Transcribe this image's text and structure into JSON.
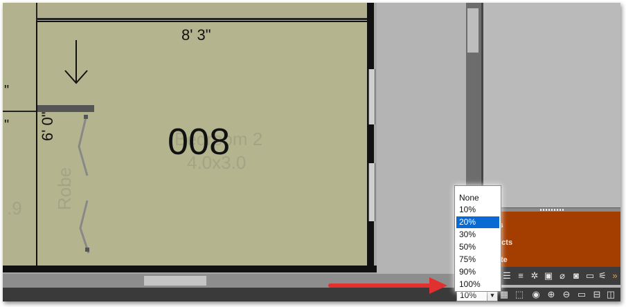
{
  "floor_plan": {
    "dimension_top": "8' 3\"",
    "dimension_side": "6' 0\"",
    "room_number": "008",
    "room_name": "Bedroom 2",
    "room_size": "4.0x3.0",
    "robe_label": "Robe",
    "left_partial_dims": [
      "\"",
      "\""
    ],
    "left_partial_value": ".9"
  },
  "right_panel": {
    "items": [
      "oms",
      "oducts",
      "imate"
    ],
    "accent_color": "#a43d00"
  },
  "zoom": {
    "current": "10%",
    "options": [
      "None",
      "10%",
      "20%",
      "30%",
      "50%",
      "75%",
      "90%",
      "100%"
    ],
    "highlighted": "20%"
  },
  "annotation": {
    "arrow_color": "#e03030"
  },
  "icons": {
    "right_toolbar": [
      "list-icon",
      "rows-icon",
      "gear-icon",
      "3d-box-icon",
      "paperclip-icon",
      "camera-icon",
      "note-icon",
      "filter-icon",
      "expand-chevron-icon"
    ],
    "status_bar": [
      "grid-view-icon",
      "select-region-icon",
      "orbit-icon",
      "zoom-in-icon",
      "zoom-out-icon",
      "window-icon",
      "split-horizontal-icon",
      "split-vertical-icon"
    ]
  }
}
